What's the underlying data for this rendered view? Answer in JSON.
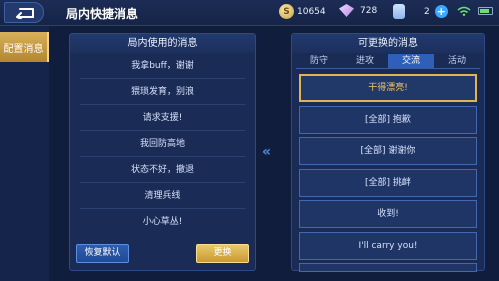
{
  "header": {
    "title": "局内快捷消息",
    "currencies": [
      {
        "icon": "gold-coin-icon",
        "symbol": "S",
        "value": "10654"
      },
      {
        "icon": "diamond-icon",
        "value": "728"
      },
      {
        "icon": "ticket-icon",
        "value": "2"
      }
    ]
  },
  "sidebar": {
    "items": [
      {
        "label": "配置消息",
        "active": true
      }
    ]
  },
  "left_panel": {
    "title": "局内使用的消息",
    "messages": [
      "我拿buff，谢谢",
      "猥琐发育，别浪",
      "请求支援!",
      "我回防高地",
      "状态不好，撤退",
      "清理兵线",
      "小心草丛!"
    ],
    "reset_label": "恢复默认",
    "replace_label": "更换"
  },
  "middle": {
    "arrow": "«"
  },
  "right_panel": {
    "title": "可更换的消息",
    "tabs": [
      {
        "label": "防守",
        "active": false
      },
      {
        "label": "进攻",
        "active": false
      },
      {
        "label": "交流",
        "active": true
      },
      {
        "label": "活动",
        "active": false
      }
    ],
    "options": [
      {
        "label": "干得漂亮!",
        "selected": true
      },
      {
        "label": "[全部] 抱歉",
        "selected": false
      },
      {
        "label": "[全部] 谢谢你",
        "selected": false
      },
      {
        "label": "[全部] 挑衅",
        "selected": false
      },
      {
        "label": "收到!",
        "selected": false
      },
      {
        "label": "I'll carry you!",
        "selected": false
      }
    ]
  },
  "colors": {
    "background": "#101d3c",
    "panel": "#1a2b55",
    "accent_gold": "#e0b455",
    "accent_blue": "#2f5fb8"
  }
}
